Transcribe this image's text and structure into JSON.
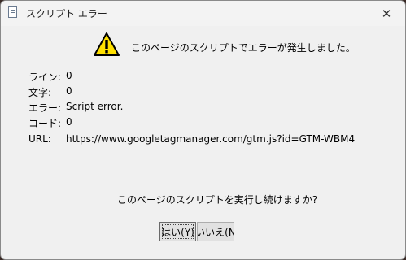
{
  "window": {
    "title": "スクリプト エラー",
    "close_glyph": "✕"
  },
  "dialog": {
    "icon": "warning-triangle-icon",
    "headline": "このページのスクリプトでエラーが発生しました。",
    "details": [
      {
        "label": "ライン:",
        "value": "0"
      },
      {
        "label": "文字:",
        "value": "0"
      },
      {
        "label": "エラー:",
        "value": "Script error."
      },
      {
        "label": "コード:",
        "value": "0"
      },
      {
        "label": "URL:",
        "value": "https://www.googletagmanager.com/gtm.js?id=GTM-WBM4"
      }
    ],
    "question": "このページのスクリプトを実行し続けますか?",
    "buttons": {
      "yes_label": "はい(Y)",
      "no_label": "いいえ(N"
    }
  },
  "colors": {
    "warning_fill": "#ffe000",
    "warning_outline": "#000000",
    "dialog_bg": "#f0f0f0"
  }
}
